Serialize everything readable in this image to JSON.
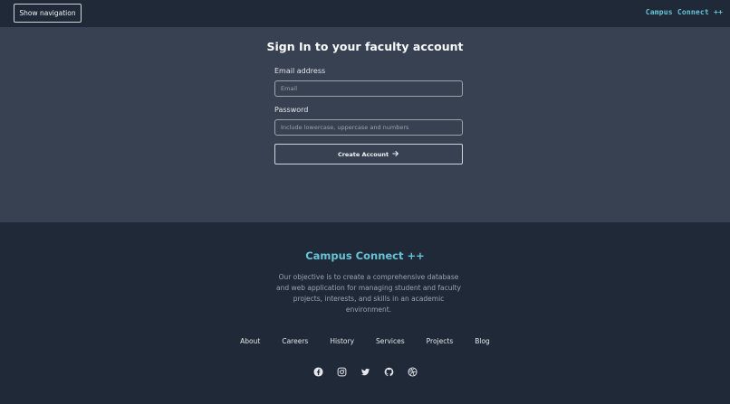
{
  "header": {
    "nav_button_label": "Show navigation",
    "brand": "Campus Connect ++"
  },
  "form": {
    "title": "Sign In to your faculty account",
    "email_label": "Email address",
    "email_placeholder": "Email",
    "email_value": "",
    "password_label": "Password",
    "password_placeholder": "Include lowercase, uppercase and numbers",
    "password_value": "",
    "submit_label": "Create Account",
    "submit_icon": "arrow-right-icon"
  },
  "footer": {
    "brand": "Campus Connect ++",
    "description": "Our objective is to create a comprehensive database and web application for managing student and faculty projects, interests, and skills in an academic environment.",
    "links": [
      "About",
      "Careers",
      "History",
      "Services",
      "Projects",
      "Blog"
    ],
    "socials": [
      "facebook-icon",
      "instagram-icon",
      "twitter-icon",
      "github-icon",
      "dribbble-icon"
    ]
  },
  "colors": {
    "accent": "#67c3d6",
    "header_bg": "#1f2937",
    "main_bg": "#374151"
  }
}
